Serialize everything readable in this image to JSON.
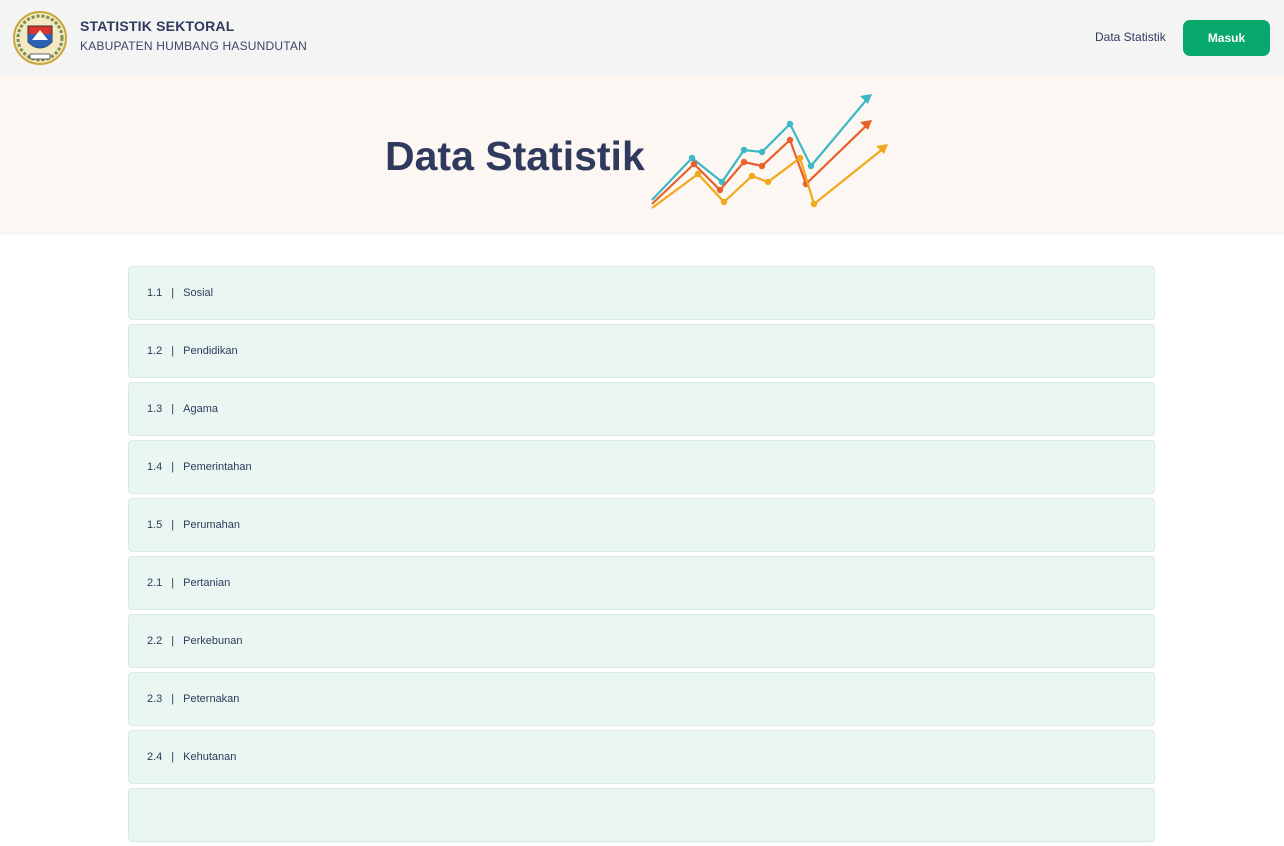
{
  "header": {
    "title": "STATISTIK SEKTORAL",
    "subtitle": "KABUPATEN HUMBANG HASUNDUTAN",
    "nav_label": "Data Statistik",
    "login_label": "Masuk"
  },
  "hero": {
    "title": "Data Statistik"
  },
  "colors": {
    "brand_green": "#07a86b",
    "text_navy": "#2f3a5e",
    "item_bg": "#eaf6f1",
    "hero_bg": "#fcf7f2",
    "chart_teal": "#3bb8c4",
    "chart_orange": "#e8602c",
    "chart_yellow": "#f2a81d"
  },
  "categories": [
    {
      "code": "1.1",
      "sep": "|",
      "label": "Sosial"
    },
    {
      "code": "1.2",
      "sep": "|",
      "label": "Pendidikan"
    },
    {
      "code": "1.3",
      "sep": "|",
      "label": "Agama"
    },
    {
      "code": "1.4",
      "sep": "|",
      "label": "Pemerintahan"
    },
    {
      "code": "1.5",
      "sep": "|",
      "label": "Perumahan"
    },
    {
      "code": "2.1",
      "sep": "|",
      "label": "Pertanian"
    },
    {
      "code": "2.2",
      "sep": "|",
      "label": "Perkebunan"
    },
    {
      "code": "2.3",
      "sep": "|",
      "label": "Peternakan"
    },
    {
      "code": "2.4",
      "sep": "|",
      "label": "Kehutanan"
    },
    {
      "code": "",
      "sep": "",
      "label": ""
    }
  ]
}
